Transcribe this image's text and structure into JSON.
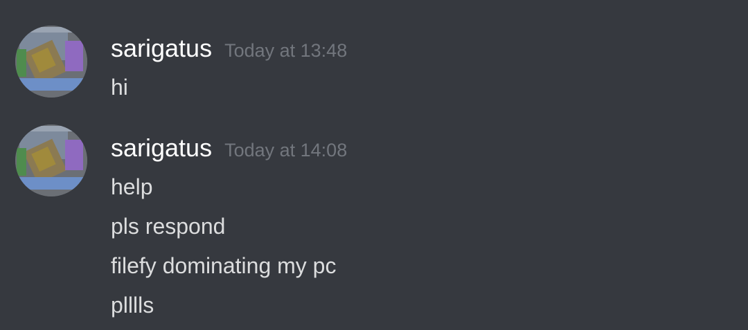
{
  "messages": [
    {
      "username": "sarigatus",
      "timestamp": "Today at 13:48",
      "avatar_icon": "user-avatar",
      "lines": [
        "hi"
      ]
    },
    {
      "username": "sarigatus",
      "timestamp": "Today at 14:08",
      "avatar_icon": "user-avatar",
      "lines": [
        "help",
        "pls respond",
        "filefy dominating my pc",
        "plllls"
      ]
    }
  ],
  "colors": {
    "background": "#36393f",
    "username": "#ffffff",
    "timestamp": "#72767d",
    "message_text": "#dcddde"
  }
}
